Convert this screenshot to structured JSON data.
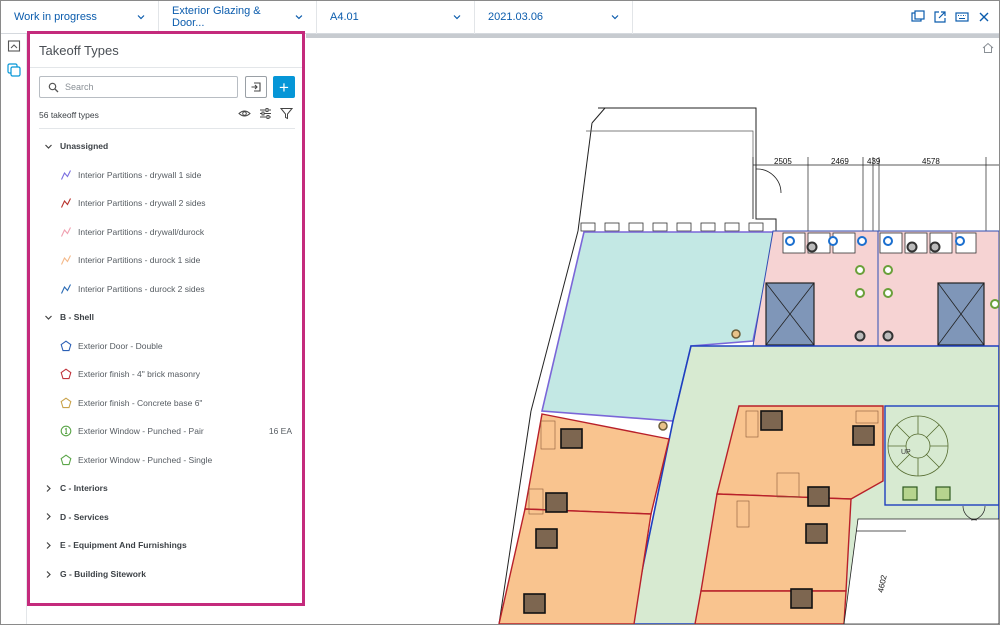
{
  "topbar": {
    "status": "Work in progress",
    "set": "Exterior Glazing & Door...",
    "sheet": "A4.01",
    "date": "2021.03.06"
  },
  "panel": {
    "title": "Takeoff Types",
    "search_placeholder": "Search",
    "add_label": "+",
    "count": "56 takeoff types"
  },
  "groups": [
    {
      "label": "Unassigned",
      "expanded": true,
      "items": [
        {
          "label": "Interior Partitions - drywall 1 side",
          "icon": "line-icon",
          "color": "#7b6fe0",
          "qty": ""
        },
        {
          "label": "Interior Partitions - drywall 2 sides",
          "icon": "line-icon",
          "color": "#b8322c",
          "qty": ""
        },
        {
          "label": "Interior Partitions - drywall/durock",
          "icon": "line-icon",
          "color": "#f0a0b0",
          "qty": ""
        },
        {
          "label": "Interior Partitions - durock 1 side",
          "icon": "line-icon",
          "color": "#f4b98a",
          "qty": ""
        },
        {
          "label": "Interior Partitions - durock 2 sides",
          "icon": "line-icon",
          "color": "#2a6bb5",
          "qty": ""
        }
      ]
    },
    {
      "label": "B - Shell",
      "expanded": true,
      "items": [
        {
          "label": "Exterior Door - Double",
          "icon": "pentagon-icon",
          "color": "#2b5fb5",
          "qty": ""
        },
        {
          "label": "Exterior finish - 4\" brick masonry",
          "icon": "pentagon-icon",
          "color": "#c0323a",
          "qty": ""
        },
        {
          "label": "Exterior finish - Concrete base 6\"",
          "icon": "pentagon-icon",
          "color": "#c9a24a",
          "qty": ""
        },
        {
          "label": "Exterior Window - Punched - Pair",
          "icon": "count-icon",
          "color": "#5aa548",
          "qty": "16 EA"
        },
        {
          "label": "Exterior Window - Punched - Single",
          "icon": "pentagon-icon",
          "color": "#5aa548",
          "qty": ""
        }
      ]
    },
    {
      "label": "C - Interiors",
      "expanded": false,
      "items": []
    },
    {
      "label": "D - Services",
      "expanded": false,
      "items": []
    },
    {
      "label": "E - Equipment And Furnishings",
      "expanded": false,
      "items": []
    },
    {
      "label": "G - Building Sitework",
      "expanded": false,
      "items": []
    }
  ],
  "drawing": {
    "dimensions": [
      "2505",
      "2469",
      "439",
      "4578",
      "4602"
    ],
    "stair_label": "UP"
  },
  "colors": {
    "accent": "#0696d7",
    "link": "#0b5cad",
    "panel_border": "#c42a7c",
    "room_orange": "#f9c48f",
    "room_teal": "#c3e8e4",
    "room_pink": "#f6d3d3",
    "corridor_green": "#d7ead1"
  }
}
